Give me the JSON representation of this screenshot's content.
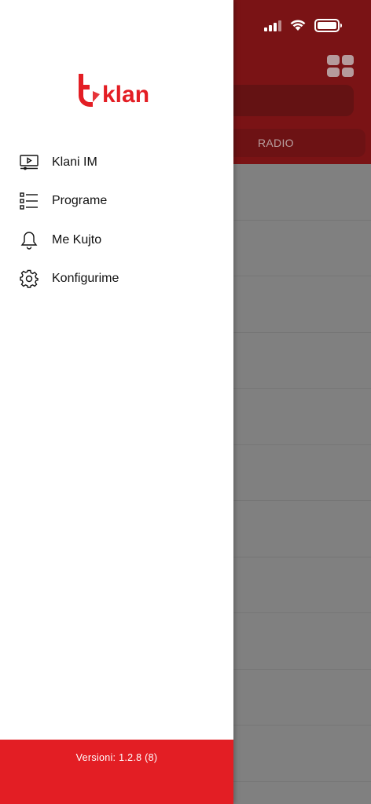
{
  "drawer": {
    "brand": "klan",
    "menu": [
      {
        "label": "Klani IM",
        "icon": "tv-play-icon"
      },
      {
        "label": "Programe",
        "icon": "list-icon"
      },
      {
        "label": "Me Kujto",
        "icon": "bell-icon"
      },
      {
        "label": "Konfigurime",
        "icon": "gear-icon"
      }
    ],
    "version": "Versioni: 1.2.8 (8)"
  },
  "background": {
    "tab_radio": "RADIO"
  },
  "colors": {
    "brand_red": "#e31e24",
    "header_dimmed": "#7a1315"
  }
}
